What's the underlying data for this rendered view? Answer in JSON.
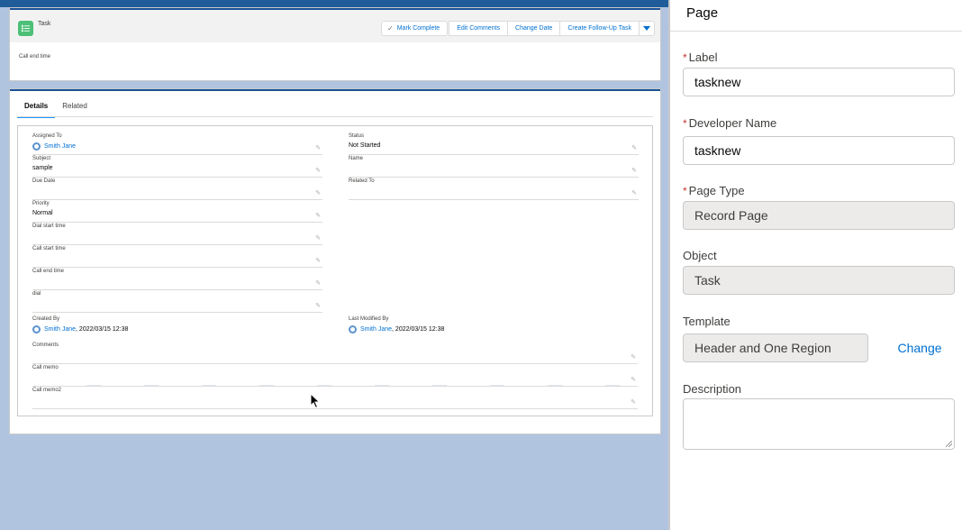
{
  "header": {
    "object_name": "Task",
    "field_label": "Call end time",
    "buttons": {
      "mark_complete": "Mark Complete",
      "edit_comments": "Edit Comments",
      "change_date": "Change Date",
      "create_follow_up": "Create Follow-Up Task"
    }
  },
  "tabs": [
    "Details",
    "Related"
  ],
  "details": {
    "assigned_to": {
      "label": "Assigned To",
      "value": "Smith Jane"
    },
    "status": {
      "label": "Status",
      "value": "Not Started"
    },
    "subject": {
      "label": "Subject",
      "value": "sample"
    },
    "name": {
      "label": "Name",
      "value": ""
    },
    "due_date": {
      "label": "Due Date",
      "value": ""
    },
    "related_to": {
      "label": "Related To",
      "value": ""
    },
    "priority": {
      "label": "Priority",
      "value": "Normal"
    },
    "dial_start_time": {
      "label": "Dial start time",
      "value": ""
    },
    "call_start_time": {
      "label": "Call start time",
      "value": ""
    },
    "call_end_time": {
      "label": "Call end time",
      "value": ""
    },
    "dial": {
      "label": "dial",
      "value": ""
    },
    "created_by": {
      "label": "Created By",
      "user": "Smith Jane",
      "date": ", 2022/03/15 12:38"
    },
    "last_modified_by": {
      "label": "Last Modified By",
      "user": "Smith Jane",
      "date": ", 2022/03/15 12:38"
    },
    "comments": {
      "label": "Comments",
      "value": ""
    },
    "call_memo": {
      "label": "Call memo",
      "value": ""
    },
    "call_memo2": {
      "label": "Call memo2",
      "value": ""
    }
  },
  "panel": {
    "title": "Page",
    "label": {
      "label": "Label",
      "value": "tasknew"
    },
    "developer_name": {
      "label": "Developer Name",
      "value": "tasknew"
    },
    "page_type": {
      "label": "Page Type",
      "value": "Record Page"
    },
    "object": {
      "label": "Object",
      "value": "Task"
    },
    "template": {
      "label": "Template",
      "value": "Header and One Region",
      "change": "Change"
    },
    "description": {
      "label": "Description",
      "value": ""
    }
  },
  "colors": {
    "brand_blue": "#0070d2",
    "task_icon": "#4bc076",
    "required": "#c23934",
    "canvas_bg": "#b0c4df"
  }
}
